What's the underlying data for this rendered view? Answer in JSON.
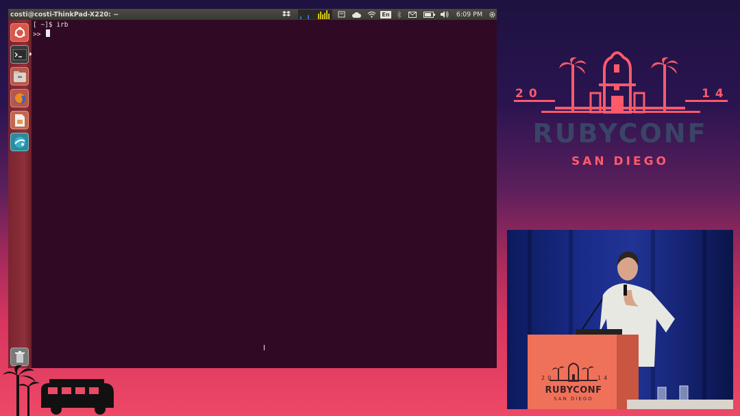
{
  "topbar": {
    "window_title": "costi@costi-ThinkPad-X220: ~",
    "language": "En",
    "time": "6:09 PM"
  },
  "launcher": {
    "items": [
      "dash-icon",
      "terminal-icon",
      "files-icon",
      "firefox-icon",
      "libreoffice-impress-icon",
      "network-app-icon"
    ]
  },
  "terminal": {
    "lines": [
      "[ ~]$ irb",
      ">> "
    ]
  },
  "branding": {
    "year_left": "20",
    "year_right": "14",
    "name": "RUBYCONF",
    "city": "SAN DIEGO"
  },
  "podium": {
    "year_left": "20",
    "year_right": "14",
    "name": "RUBYCONF",
    "city": "SAN DIEGO"
  },
  "colors": {
    "terminal_bg": "#300a24",
    "brand_coral": "#ff5a6c",
    "brand_slate": "#3a4466",
    "launcher": "#8e3039"
  }
}
